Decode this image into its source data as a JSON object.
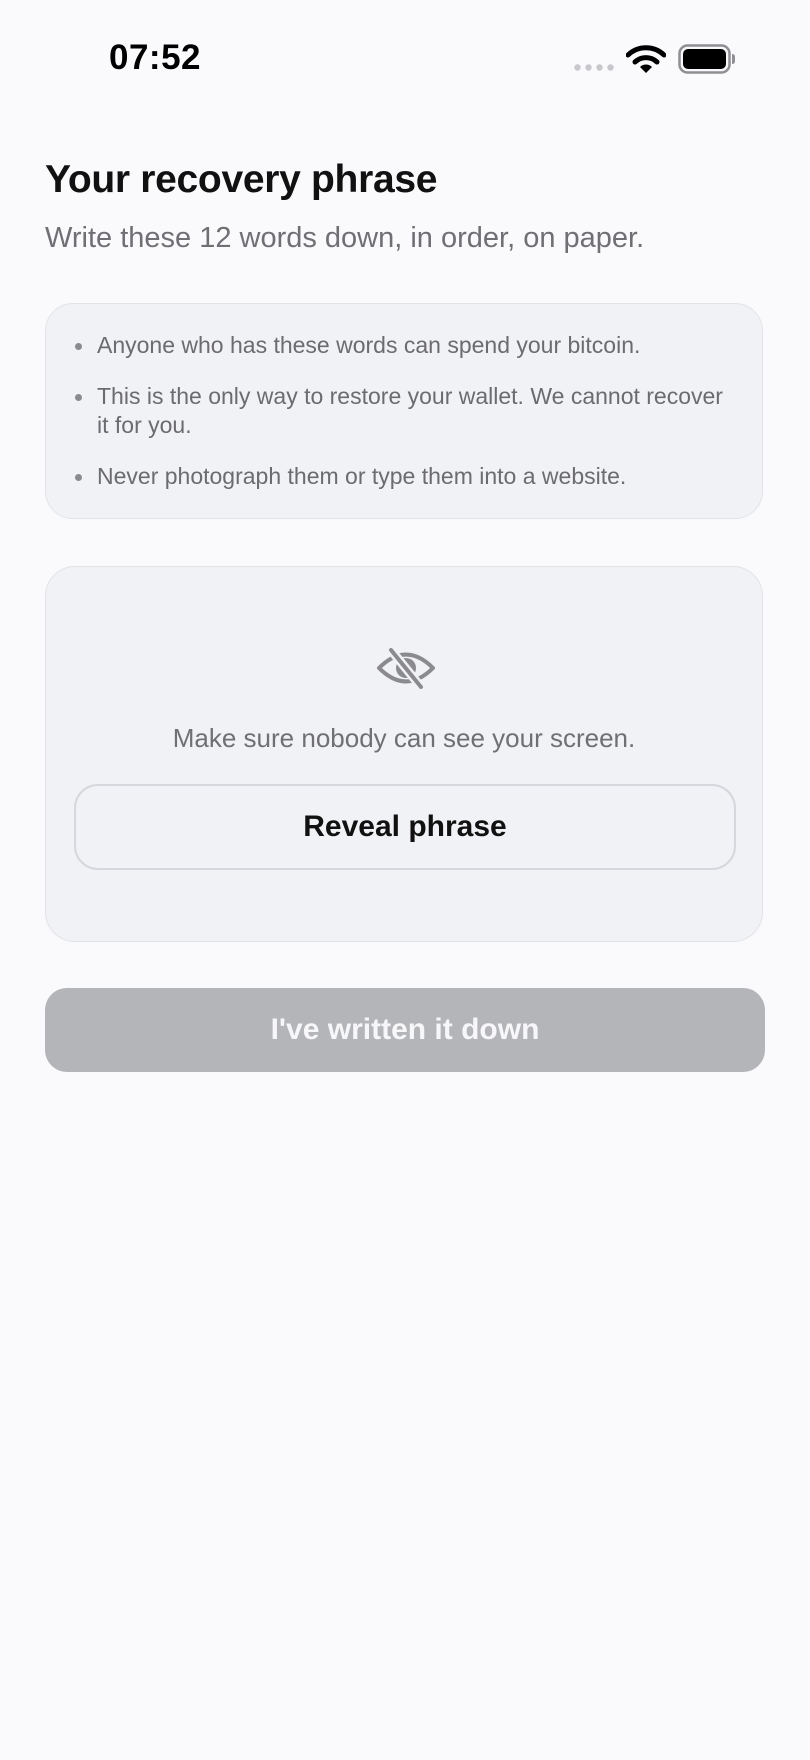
{
  "status_bar": {
    "time": "07:52"
  },
  "header": {
    "title": "Your recovery phrase",
    "subtitle": "Write these 12 words down, in order, on paper."
  },
  "warnings": {
    "items": [
      "Anyone who has these words can spend your bitcoin.",
      "This is the only way to restore your wallet. We cannot recover it for you.",
      "Never photograph them or type them into a website."
    ]
  },
  "reveal": {
    "icon": "eye-slash-icon",
    "message": "Make sure nobody can see your screen.",
    "button_label": "Reveal phrase"
  },
  "confirm": {
    "label": "I've written it down",
    "enabled": false
  },
  "colors": {
    "background": "#fafafc",
    "card": "#f1f2f5",
    "text_primary": "#111111",
    "text_secondary": "#6f6f74",
    "disabled_button": "#b4b5b8"
  }
}
